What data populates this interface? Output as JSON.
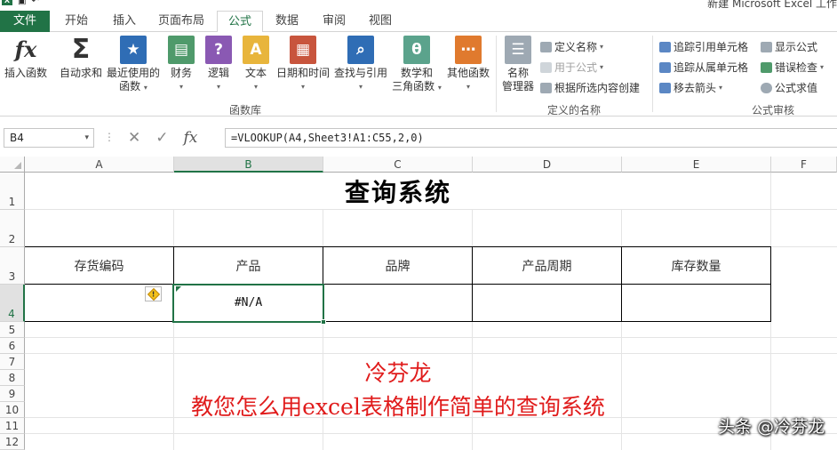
{
  "titlebar": {
    "window_title": "新建 Microsoft Excel 工作"
  },
  "tabs": [
    {
      "label": "文件",
      "type": "file"
    },
    {
      "label": "开始"
    },
    {
      "label": "插入"
    },
    {
      "label": "页面布局"
    },
    {
      "label": "公式",
      "active": true
    },
    {
      "label": "数据"
    },
    {
      "label": "审阅"
    },
    {
      "label": "视图"
    }
  ],
  "ribbon": {
    "library": {
      "group_label": "函数库",
      "buttons": [
        {
          "line1": "插入函数",
          "icon": "fx-icon"
        },
        {
          "line1": "自动求和",
          "icon": "sigma-icon"
        },
        {
          "line1": "最近使用的",
          "line2": "函数",
          "icon": "star-icon"
        },
        {
          "line1": "财务",
          "icon": "finance-icon"
        },
        {
          "line1": "逻辑",
          "icon": "logic-icon"
        },
        {
          "line1": "文本",
          "icon": "text-icon"
        },
        {
          "line1": "日期和时间",
          "icon": "calendar-icon"
        },
        {
          "line1": "查找与引用",
          "icon": "lookup-icon"
        },
        {
          "line1": "数学和",
          "line2": "三角函数",
          "icon": "math-icon"
        },
        {
          "line1": "其他函数",
          "icon": "more-functions-icon"
        }
      ]
    },
    "names": {
      "group_label": "定义的名称",
      "manager_line1": "名称",
      "manager_line2": "管理器",
      "define_name": "定义名称",
      "use_in_formula": "用于公式",
      "create_from_selection": "根据所选内容创建"
    },
    "audit": {
      "group_label": "公式审核",
      "trace_precedents": "追踪引用单元格",
      "trace_dependents": "追踪从属单元格",
      "remove_arrows": "移去箭头",
      "show_formulas": "显示公式",
      "error_checking": "错误检查",
      "evaluate_formula": "公式求值"
    }
  },
  "formula_bar": {
    "name_box": "B4",
    "formula": "=VLOOKUP(A4,Sheet3!A1:C55,2,0)"
  },
  "grid": {
    "columns": [
      "A",
      "B",
      "C",
      "D",
      "E",
      "F"
    ],
    "rows": [
      "1",
      "2",
      "3",
      "4",
      "5",
      "6",
      "7",
      "8",
      "9",
      "10",
      "11",
      "12"
    ],
    "selected_cell": "B4",
    "title": "查询系统",
    "headers": [
      "存货编码",
      "产品",
      "品牌",
      "产品周期",
      "库存数量"
    ],
    "b4_value": "#N/A",
    "promo_line1": "冷芬龙",
    "promo_line2": "教您怎么用excel表格制作简单的查询系统"
  },
  "watermark": "头条 @冷芬龙",
  "colors": {
    "excel_green": "#217346",
    "promo_red": "#e01b1b",
    "gridline": "#e4e4e4"
  }
}
